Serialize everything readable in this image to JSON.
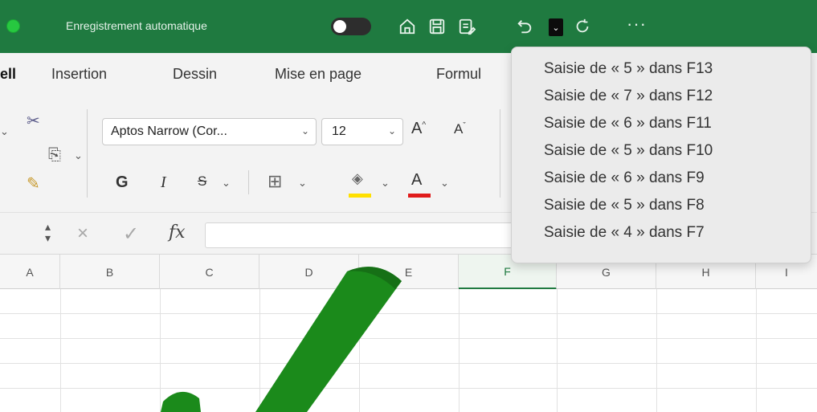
{
  "titlebar": {
    "autosave_label": "Enregistrement automatique",
    "autosave_state": "off",
    "more_label": "···",
    "icons": [
      "home-icon",
      "save-icon",
      "save-as-icon",
      "undo-icon",
      "undo-dropdown-icon",
      "redo-icon",
      "more-icon"
    ]
  },
  "tabs": [
    {
      "label": "ell",
      "active": true
    },
    {
      "label": "Insertion",
      "active": false
    },
    {
      "label": "Dessin",
      "active": false
    },
    {
      "label": "Mise en page",
      "active": false
    },
    {
      "label": "Formul",
      "active": false
    }
  ],
  "ribbon": {
    "font_name": "Aptos Narrow (Cor...",
    "font_size": "12",
    "bold_label": "G",
    "italic_label": "I",
    "strike_label": "S",
    "grow_font_label": "A",
    "shrink_font_label": "A",
    "font_color_label": "A",
    "colors": {
      "highlight": "#ffe000",
      "font": "#e01b1b",
      "accent": "#1f7a40"
    }
  },
  "formula_bar": {
    "fx_label": "fx",
    "cancel_label": "×",
    "confirm_label": "✓",
    "value": ""
  },
  "columns": [
    {
      "label": "A",
      "selected": false
    },
    {
      "label": "B",
      "selected": false
    },
    {
      "label": "C",
      "selected": false
    },
    {
      "label": "D",
      "selected": false
    },
    {
      "label": "E",
      "selected": false
    },
    {
      "label": "F",
      "selected": true
    },
    {
      "label": "G",
      "selected": false
    },
    {
      "label": "H",
      "selected": false
    },
    {
      "label": "I",
      "selected": false
    }
  ],
  "undo_menu": {
    "items": [
      "Saisie de « 5 » dans F13",
      "Saisie de « 7 » dans F12",
      "Saisie de « 6 » dans F11",
      "Saisie de « 5 » dans F10",
      "Saisie de « 6 » dans F9",
      "Saisie de « 5 » dans F8",
      "Saisie de « 4 » dans F7"
    ]
  },
  "overlay": {
    "icon": "checkmark-icon",
    "color": "#1b8a1b"
  }
}
